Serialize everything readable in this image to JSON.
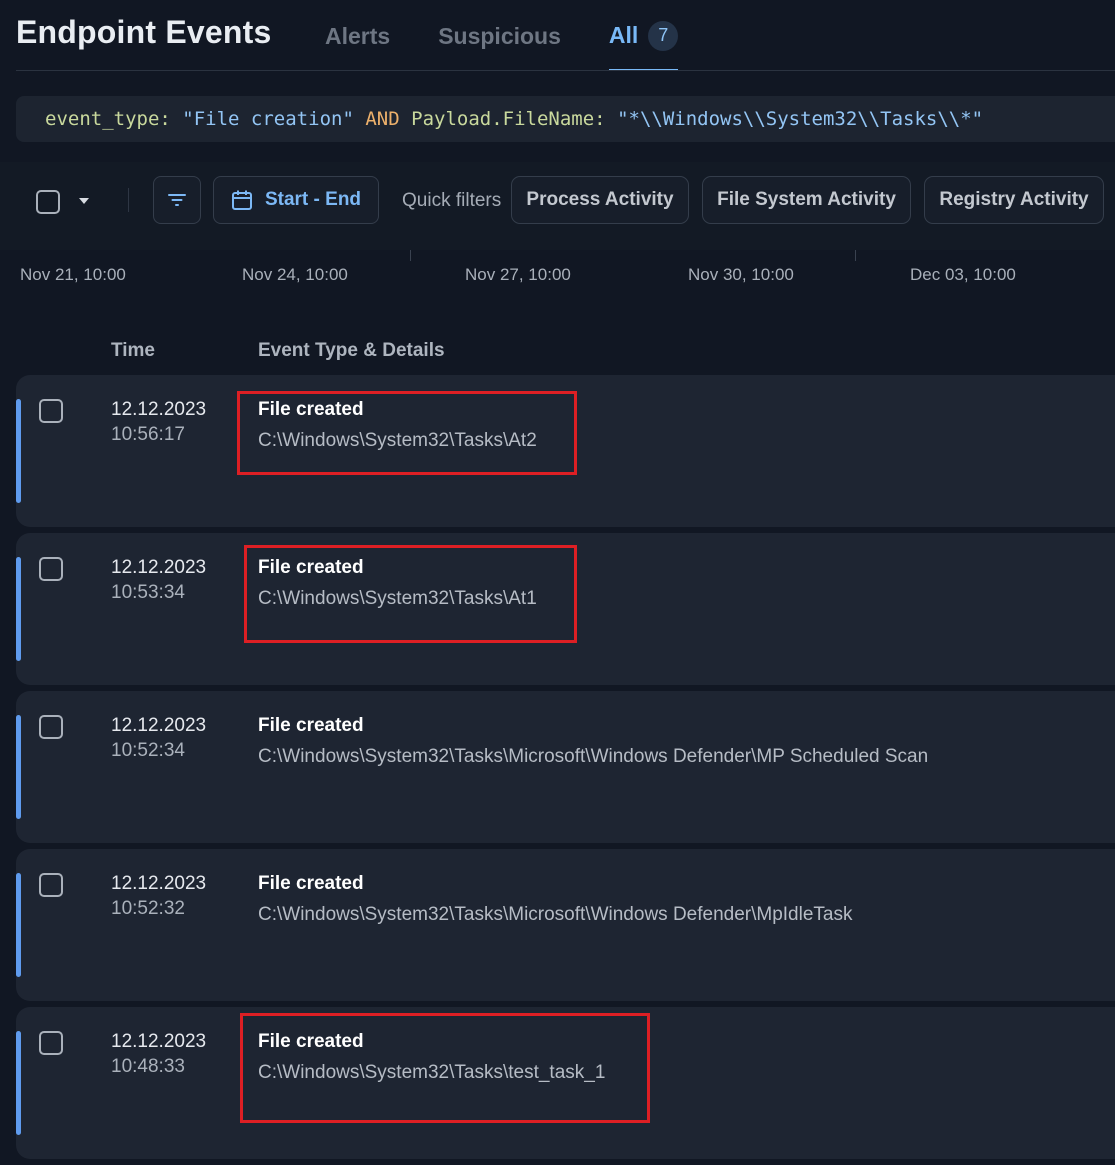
{
  "header": {
    "title": "Endpoint Events",
    "tabs": [
      {
        "label": "Alerts"
      },
      {
        "label": "Suspicious"
      },
      {
        "label": "All",
        "count": "7"
      }
    ]
  },
  "query": {
    "k1": "event_type",
    "c1": ":",
    "v1": "\"File creation\"",
    "op": "AND",
    "k2": "Payload.FileName",
    "c2": ":",
    "v2": "\"*\\\\Windows\\\\System32\\\\Tasks\\\\*\""
  },
  "toolbar": {
    "date_range": "Start - End",
    "quick_filters_label": "Quick filters",
    "quick_filters": [
      "Process Activity",
      "File System Activity",
      "Registry Activity"
    ]
  },
  "timeline": {
    "ticks": [
      "Nov 21, 10:00",
      "Nov 24, 10:00",
      "Nov 27, 10:00",
      "Nov 30, 10:00",
      "Dec 03, 10:00"
    ]
  },
  "columns": {
    "time": "Time",
    "details": "Event Type & Details"
  },
  "events": [
    {
      "date": "12.12.2023",
      "time": "10:56:17",
      "type": "File created",
      "path": "C:\\Windows\\System32\\Tasks\\At2",
      "highlighted": true
    },
    {
      "date": "12.12.2023",
      "time": "10:53:34",
      "type": "File created",
      "path": "C:\\Windows\\System32\\Tasks\\At1",
      "highlighted": true
    },
    {
      "date": "12.12.2023",
      "time": "10:52:34",
      "type": "File created",
      "path": "C:\\Windows\\System32\\Tasks\\Microsoft\\Windows Defender\\MP Scheduled Scan",
      "highlighted": false
    },
    {
      "date": "12.12.2023",
      "time": "10:52:32",
      "type": "File created",
      "path": "C:\\Windows\\System32\\Tasks\\Microsoft\\Windows Defender\\MpIdleTask",
      "highlighted": false
    },
    {
      "date": "12.12.2023",
      "time": "10:48:33",
      "type": "File created",
      "path": "C:\\Windows\\System32\\Tasks\\test_task_1",
      "highlighted": true
    }
  ],
  "colors": {
    "accent": "#79b9f7",
    "highlight": "#dd1f24",
    "row_accent": "#5f9bee"
  }
}
